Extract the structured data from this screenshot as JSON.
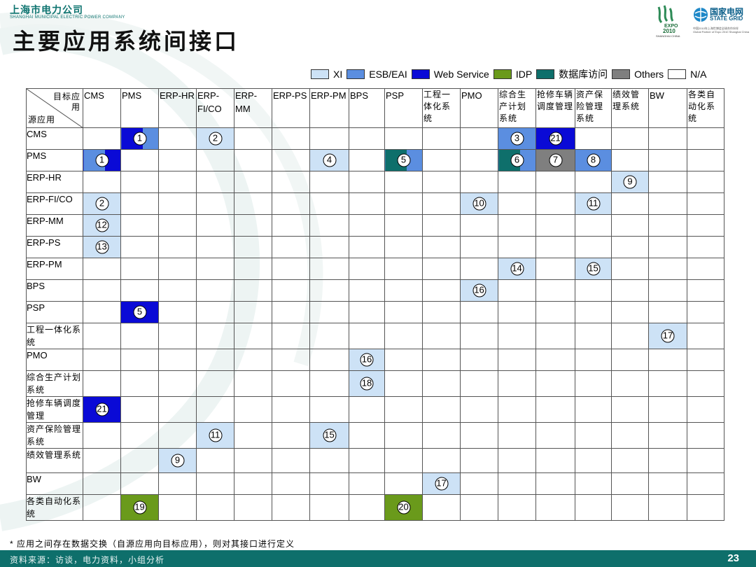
{
  "header": {
    "company_name": "上海市电力公司",
    "company_name_en": "SHANGHAI MUNICIPAL ELECTRIC POWER COMPANY",
    "expo_mark": "EXPO",
    "expo_year": "2010",
    "expo_city": "SHANGHAI CHINA",
    "stategrid_cn": "国家电网",
    "stategrid_en": "STATE GRID",
    "stategrid_sub1": "中国2010年上海世博会全球合作伙伴",
    "stategrid_sub2": "Global Partner of Expo 2010 Shanghai China"
  },
  "title": "主要应用系统间接口",
  "legend": [
    {
      "key": "xi",
      "label": "XI",
      "color": "#cde2f6"
    },
    {
      "key": "esb",
      "label": "ESB/EAI",
      "color": "#5b8ee0"
    },
    {
      "key": "ws",
      "label": "Web Service",
      "color": "#0a0ad6"
    },
    {
      "key": "idp",
      "label": "IDP",
      "color": "#6a9a1b"
    },
    {
      "key": "db",
      "label": "数据库访问",
      "color": "#0e6f6b"
    },
    {
      "key": "others",
      "label": "Others",
      "color": "#7f7f7f"
    },
    {
      "key": "na",
      "label": "N/A",
      "color": "#ffffff"
    }
  ],
  "matrix": {
    "corner_target": "目标应用",
    "corner_source": "源应用",
    "columns": [
      "CMS",
      "PMS",
      "ERP-HR",
      "ERP-FI/CO",
      "ERP-MM",
      "ERP-PS",
      "ERP-PM",
      "BPS",
      "PSP",
      "工程一体化系统",
      "PMO",
      "综合生产计划系统",
      "抢修车辆调度管理",
      "资产保险管理系统",
      "绩效管理系统",
      "BW",
      "各类自动化系统"
    ],
    "rows": [
      "CMS",
      "PMS",
      "ERP-HR",
      "ERP-FI/CO",
      "ERP-MM",
      "ERP-PS",
      "ERP-PM",
      "BPS",
      "PSP",
      "工程一体化系统",
      "PMO",
      "综合生产计划系统",
      "抢修车辆调度管理",
      "资产保险管理系统",
      "绩效管理系统",
      "BW",
      "各类自动化系统"
    ],
    "interfaces": [
      {
        "row": 0,
        "col": 1,
        "num": "1",
        "type": "ws",
        "split": "esb"
      },
      {
        "row": 0,
        "col": 3,
        "num": "2",
        "type": "xi"
      },
      {
        "row": 0,
        "col": 11,
        "num": "3",
        "type": "esb"
      },
      {
        "row": 0,
        "col": 12,
        "num": "21",
        "type": "ws"
      },
      {
        "row": 1,
        "col": 0,
        "num": "1",
        "type": "esb",
        "split": "ws"
      },
      {
        "row": 1,
        "col": 6,
        "num": "4",
        "type": "xi"
      },
      {
        "row": 1,
        "col": 8,
        "num": "5",
        "type": "db",
        "split": "esb"
      },
      {
        "row": 1,
        "col": 11,
        "num": "6",
        "type": "db",
        "split": "esb"
      },
      {
        "row": 1,
        "col": 12,
        "num": "7",
        "type": "others"
      },
      {
        "row": 1,
        "col": 13,
        "num": "8",
        "type": "esb"
      },
      {
        "row": 2,
        "col": 14,
        "num": "9",
        "type": "xi"
      },
      {
        "row": 3,
        "col": 0,
        "num": "2",
        "type": "xi"
      },
      {
        "row": 3,
        "col": 10,
        "num": "10",
        "type": "xi"
      },
      {
        "row": 3,
        "col": 13,
        "num": "11",
        "type": "xi"
      },
      {
        "row": 4,
        "col": 0,
        "num": "12",
        "type": "xi"
      },
      {
        "row": 5,
        "col": 0,
        "num": "13",
        "type": "xi"
      },
      {
        "row": 6,
        "col": 11,
        "num": "14",
        "type": "xi"
      },
      {
        "row": 6,
        "col": 13,
        "num": "15",
        "type": "xi"
      },
      {
        "row": 7,
        "col": 10,
        "num": "16",
        "type": "xi"
      },
      {
        "row": 8,
        "col": 1,
        "num": "5",
        "type": "ws"
      },
      {
        "row": 9,
        "col": 15,
        "num": "17",
        "type": "xi"
      },
      {
        "row": 10,
        "col": 7,
        "num": "16",
        "type": "xi"
      },
      {
        "row": 11,
        "col": 7,
        "num": "18",
        "type": "xi"
      },
      {
        "row": 12,
        "col": 0,
        "num": "21",
        "type": "ws"
      },
      {
        "row": 13,
        "col": 3,
        "num": "11",
        "type": "xi"
      },
      {
        "row": 13,
        "col": 6,
        "num": "15",
        "type": "xi"
      },
      {
        "row": 14,
        "col": 2,
        "num": "9",
        "type": "xi"
      },
      {
        "row": 15,
        "col": 9,
        "num": "17",
        "type": "xi"
      },
      {
        "row": 16,
        "col": 1,
        "num": "19",
        "type": "idp"
      },
      {
        "row": 16,
        "col": 8,
        "num": "20",
        "type": "idp"
      }
    ]
  },
  "footnote": "* 应用之间存在数据交换（自源应用向目标应用），则对其接口进行定义",
  "source": "资料来源：访谈，电力资料，小组分析",
  "page_number": "23"
}
